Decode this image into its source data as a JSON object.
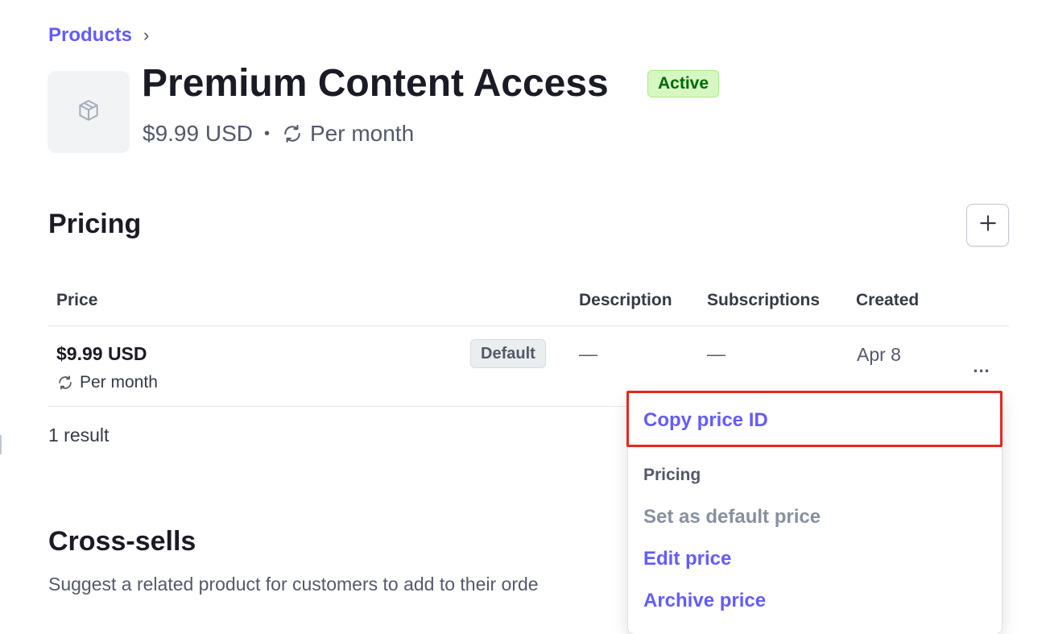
{
  "breadcrumb": {
    "products_label": "Products",
    "chevron": "›"
  },
  "product": {
    "title": "Premium Content Access",
    "status": "Active",
    "price": "$9.99 USD",
    "separator": "•",
    "interval": "Per month",
    "thumbnail_icon": "box-icon"
  },
  "pricing": {
    "heading": "Pricing",
    "add_label": "+",
    "columns": [
      "Price",
      "Description",
      "Subscriptions",
      "Created"
    ],
    "rows": [
      {
        "price": "$9.99 USD",
        "interval": "Per month",
        "badge": "Default",
        "description": "—",
        "subscriptions": "—",
        "created": "Apr 8",
        "more_label": "..."
      }
    ],
    "result_count": "1 result"
  },
  "cross_sells": {
    "heading": "Cross-sells",
    "description": "Suggest a related product for customers to add to their orde"
  },
  "menu": {
    "copy_price_id": "Copy price ID",
    "section_pricing": "Pricing",
    "set_default": "Set as default price",
    "edit_price": "Edit price",
    "archive_price": "Archive price"
  },
  "colors": {
    "accent": "#635bff",
    "status_green_bg": "#d7f7c2",
    "status_green_text": "#006908",
    "highlight_red": "#e8261c"
  }
}
